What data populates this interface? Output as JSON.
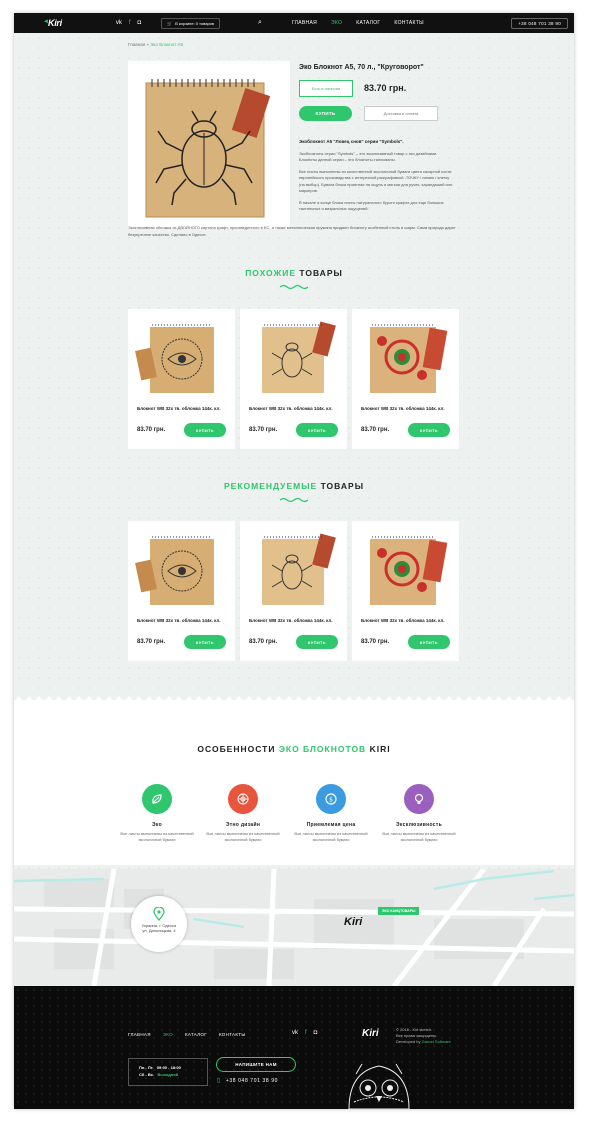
{
  "header": {
    "logo": "Kiri",
    "social": [
      "vk",
      "f",
      "ig"
    ],
    "cart": "В корзине: 0 товаров",
    "nav": [
      "ГЛАВНАЯ",
      "ЭКО",
      "КАТАЛОГ",
      "КОНТАКТЫ"
    ],
    "phone": "+38 048 701 38 90"
  },
  "breadcrumb": {
    "home": "Главная",
    "sep": "»",
    "current": "Эко Блокнот А5"
  },
  "product": {
    "name": "Эко Блокнот А5, 70 л., \"Круговорот\"",
    "stock": "Есть в наличии",
    "price": "83.70 грн.",
    "buy": "КУПИТЬ",
    "delivery": "Доставка и оплата",
    "desc_head": "Экоблокнот А5 \"Ловец снов\" серии \"Symbols\".",
    "desc_p1": "Экоблокноты серии \"Symbols\" – это эксклюзивный товар с эко дизайнами. Блокноты данной серии – это блокноты-талисманы.",
    "desc_p2": "Все листы выполнены из качественной экологичной бумаги цвета сахарной кости европейского производства с интересной разграфовкой -ТОЧКУ / линию / клетку (на выбор). Бумага блока приятная на ощупь и мягкая для ручек, карандашей или маркеров.",
    "desc_p3": "В начале и конце блока листы натурального бурого крафта для еще больших тактильных и визуальных ощущений.",
    "desc_wide": "Эксклюзивная обложка из ДВОЙНОГО картона крафт, произведенного в ЕС, а также металлическая пружина придают блокноту особенный стиль и шарм. Сама природа дарит безупречное качество. Сделано в Одессе."
  },
  "similar": {
    "title_green": "ПОХОЖИЕ",
    "title_dark": "ТОВАРЫ",
    "items": [
      {
        "title": "Блокнот WB 32х тв. обложка 144к. кл.",
        "price": "83.70 грн.",
        "buy": "КУПИТЬ"
      },
      {
        "title": "Блокнот WB 32х тв. обложка 144к. кл.",
        "price": "83.70 грн.",
        "buy": "КУПИТЬ"
      },
      {
        "title": "Блокнот WB 32х тв. обложка 144к. кл.",
        "price": "83.70 грн.",
        "buy": "КУПИТЬ"
      }
    ]
  },
  "recommended": {
    "title_green": "РЕКОМЕНДУЕМЫЕ",
    "title_dark": "ТОВАРЫ",
    "items": [
      {
        "title": "Блокнот WB 32х тв. обложка 144к. кл.",
        "price": "83.70 грн.",
        "buy": "КУПИТЬ"
      },
      {
        "title": "Блокнот WB 32х тв. обложка 144к. кл.",
        "price": "83.70 грн.",
        "buy": "КУПИТЬ"
      },
      {
        "title": "Блокнот WB 32х тв. обложка 144к. кл.",
        "price": "83.70 грн.",
        "buy": "КУПИТЬ"
      }
    ]
  },
  "features": {
    "title_a": "ОСОБЕННОСТИ",
    "title_green": "ЭКО БЛОКНОТОВ",
    "title_b": "KIRI",
    "items": [
      {
        "title": "Эко",
        "desc": "Все листы выполнены из качественной экологичной бумаги",
        "color": "#2fc66e",
        "icon": "leaf-icon"
      },
      {
        "title": "Этно дизайн",
        "desc": "Все листы выполнены из качественной экологичной бумаги",
        "color": "#e8553d",
        "icon": "ornament-icon"
      },
      {
        "title": "Приемлемая цена",
        "desc": "Все листы выполнены из качественной экологичной бумаги",
        "color": "#3a9be0",
        "icon": "coins-icon"
      },
      {
        "title": "Эксклюзивность",
        "desc": "Все листы выполнены из качественной экологичной бумаги",
        "color": "#9b5fc0",
        "icon": "bulb-icon"
      }
    ]
  },
  "map": {
    "address_line1": "Украина, г. Одесса",
    "address_line2": "ул. Дальницкая, 4",
    "shop_tag": "ЭКО КАНЦТОВАРЫ",
    "logo": "Kiri"
  },
  "footer": {
    "nav": [
      "ГЛАВНАЯ",
      "ЭКО",
      "КАТАЛОГ",
      "КОНТАКТЫ"
    ],
    "logo": "Kiri",
    "copy1": "© 2016 - Kiri sketch.",
    "copy2": "Все права защищены.",
    "copy3_prefix": "Developed by",
    "copy3_link": "Garnet Software",
    "hours1_days": "Пн.- Пт.",
    "hours1_time": "09:00 - 18:00",
    "hours2_days": "Сб - Вс.",
    "hours2_time": "Выходной",
    "write": "НАПИШИТЕ НАМ",
    "phone": "+38 048 701 38 90"
  },
  "colors": {
    "accent": "#2fc66e",
    "dark": "#111111",
    "page_bg": "#edf1ef"
  }
}
